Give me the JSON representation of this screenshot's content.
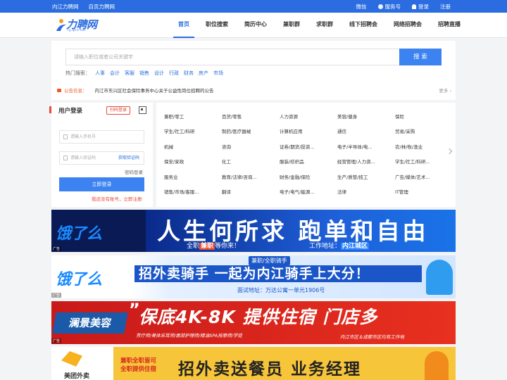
{
  "topbar": {
    "left_links": [
      "内江力聘网",
      "自贡力聘网"
    ],
    "right_links": [
      "微信",
      "服务号",
      "登录",
      "注册"
    ]
  },
  "logo": {
    "text": "力聘网",
    "sub": "nj.lpin.net"
  },
  "nav": [
    "首页",
    "职位搜索",
    "简历中心",
    "兼职群",
    "求职群",
    "线下招聘会",
    "网络招聘会",
    "招聘直播"
  ],
  "search": {
    "placeholder": "请输入职位或者公司关键字",
    "button": "搜 索",
    "hot_label": "热门搜索：",
    "hot": [
      "人事",
      "会计",
      "客服",
      "销售",
      "设计",
      "行政",
      "财务",
      "房产",
      "市场"
    ]
  },
  "notice": {
    "label": "公告信息：",
    "text": "内江市东兴区社会保险事务中心关于公益性岗位招聘的公告",
    "more": "更多 ›"
  },
  "login": {
    "title": "用户登录",
    "tab": "扫码登录",
    "phone_placeholder": "请输入手机号",
    "code_placeholder": "请输入验证码",
    "get_code": "获取验证码",
    "password_login": "密码登录",
    "submit": "立即登录",
    "register": "我还没有账号，立即注册"
  },
  "categories": [
    [
      "兼职/零工",
      "百货/零售",
      "人力资源",
      "美容/健身",
      "保险"
    ],
    [
      "学生/社工/科研",
      "制药/医疗器械",
      "计算机应用",
      "通信",
      "贸易/采购"
    ],
    [
      "机械",
      "咨询",
      "证券/期货/投资...",
      "电子/半导体/电...",
      "农/林/牧/渔业"
    ],
    [
      "保安/家政",
      "化工",
      "服装/纺织品",
      "经营管理/人力资...",
      "学生/社工/科研..."
    ],
    [
      "服务业",
      "教育/法律/咨询...",
      "财务/金融/保险",
      "生产/质管/技工",
      "广告/媒体/艺术..."
    ],
    [
      "销售/市场/客服...",
      "翻译",
      "电子/电气/能源...",
      "法律",
      "IT管理"
    ]
  ],
  "ad_tag": "广告",
  "banners": {
    "b1": {
      "brand": "饿了么",
      "headline": "人生何所求 跑单和自由",
      "sub1_a": "全职",
      "sub1_b": "兼职",
      "sub1_c": "等你来！",
      "sub2_a": "工作地址：",
      "sub2_b": "内江城区"
    },
    "b2": {
      "brand": "饿了么",
      "tag": "兼职/全职骑手",
      "headline": "招外卖骑手 一起为内江骑手上大分！",
      "addr": "面试地址：万达公寓一单元1906号"
    },
    "b3": {
      "brand": "澜景美容",
      "quote": "”",
      "headline": "保底4K-8K 提供住宿 门店多",
      "sub1": "芳疗师/美体采耳师/面部护理师/精油SPA按摩师/学徒",
      "sub2": "内江市区＆成都市区均有工作地"
    },
    "b4": {
      "brand": "美团外卖",
      "t1": "兼职全职皆可",
      "t2": "全职提供住宿",
      "headline": "招外卖送餐员 业务经理"
    }
  }
}
